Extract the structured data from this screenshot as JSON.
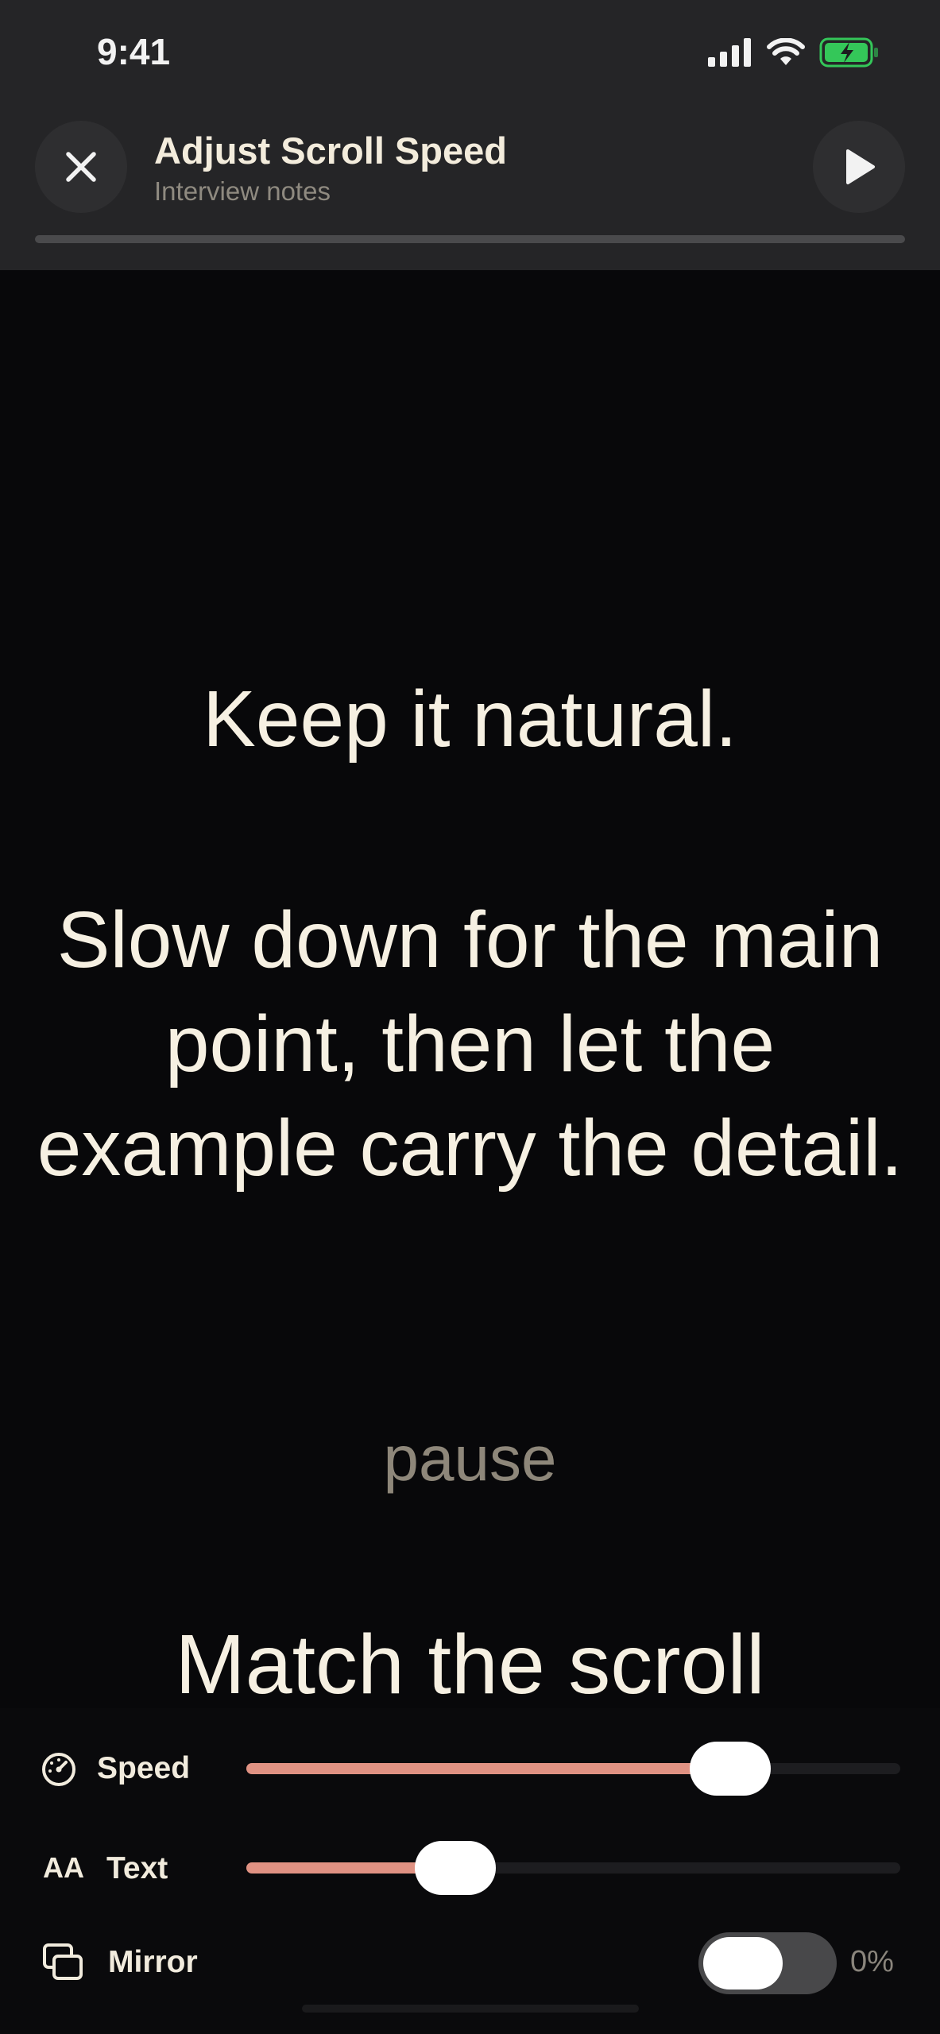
{
  "status_bar": {
    "time": "9:41"
  },
  "header": {
    "title": "Adjust Scroll Speed",
    "subtitle": "Interview notes",
    "progress_fraction": 0.0
  },
  "script": {
    "line1": "Keep it natural.",
    "line2": "Slow down for the main point, then let the example carry the detail.",
    "cue": "pause",
    "line3": "Match the scroll"
  },
  "controls": {
    "speed": {
      "label": "Speed",
      "value_fraction": 0.74
    },
    "text": {
      "label": "Text",
      "icon_text": "AA",
      "value_fraction": 0.32
    },
    "mirror": {
      "label": "Mirror",
      "value_text": "0%",
      "on": false
    }
  },
  "colors": {
    "accent": "#e09283",
    "background": "#08080a",
    "header_bg": "#252527",
    "text": "#f6f0e2",
    "battery": "#34c759"
  }
}
